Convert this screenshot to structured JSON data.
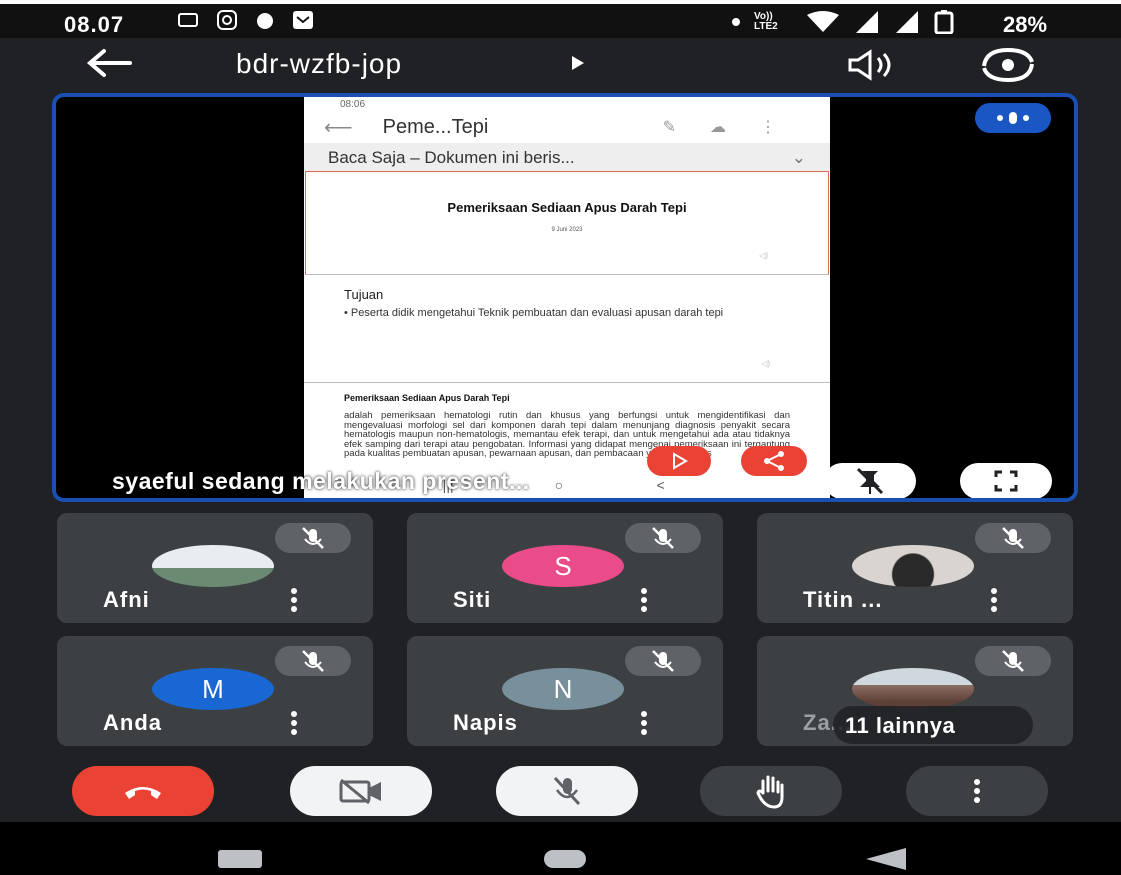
{
  "status_bar": {
    "time": "08.07",
    "network": "Vo)) LTE2",
    "battery_percent": "28%"
  },
  "header": {
    "meeting_code": "bdr-wzfb-jop"
  },
  "presentation": {
    "caption": "syaeful sedang melakukan present...",
    "shared_screen": {
      "time": "08:06",
      "doc_title": "Peme...Tepi",
      "readonly_banner": "Baca Saja – Dokumen ini beris...",
      "slide1_title": "Pemeriksaan Sediaan Apus Darah Tepi",
      "slide1_date": "9 Juni 2023",
      "slide2_heading": "Tujuan",
      "slide2_bullet": "• Peserta didik mengetahui Teknik pembuatan dan evaluasi apusan darah tepi",
      "slide3_heading": "Pemeriksaan Sediaan Apus Darah Tepi",
      "slide3_body": "adalah pemeriksaan hematologi rutin dan khusus yang berfungsi untuk mengidentifikasi dan mengevaluasi morfologi sel dari komponen darah tepi dalam menunjang diagnosis penyakit secara hematologis maupun non-hematologis, memantau efek terapi, dan untuk mengetahui ada atau tidaknya efek samping dari terapi atau pengobatan. Informasi yang didapat mengenai pemeriksaan ini tergantung pada kualitas pembuatan apusan, pewarnaan apusan, dan pembacaan yang sistematis"
    }
  },
  "participants": [
    {
      "name": "Afni",
      "avatar_type": "photo"
    },
    {
      "name": "Siti",
      "avatar_letter": "S",
      "avatar_color": "#ea4c89"
    },
    {
      "name": "Titin ...",
      "avatar_type": "photo"
    },
    {
      "name": "Anda",
      "avatar_letter": "M",
      "avatar_color": "#1967d2"
    },
    {
      "name": "Napis",
      "avatar_letter": "N",
      "avatar_color": "#78909c"
    },
    {
      "name": "Za...",
      "avatar_type": "photo"
    }
  ],
  "more_participants_label": "11 lainnya",
  "icons": {
    "status_left": [
      "cast-icon",
      "instagram-icon",
      "shield-icon",
      "message-icon"
    ],
    "status_right": [
      "dot-icon",
      "volte-icon",
      "wifi-icon",
      "signal-icon",
      "signal-icon",
      "battery-icon"
    ],
    "header": [
      "back-arrow-icon",
      "speaker-icon",
      "switch-camera-icon"
    ],
    "controls": [
      "end-call-icon",
      "camera-off-icon",
      "mic-off-icon",
      "raise-hand-icon",
      "more-vert-icon"
    ]
  },
  "colors": {
    "end_call": "#ea4335",
    "stage_border": "#1a4fb3",
    "tile_bg": "#3c4043"
  }
}
